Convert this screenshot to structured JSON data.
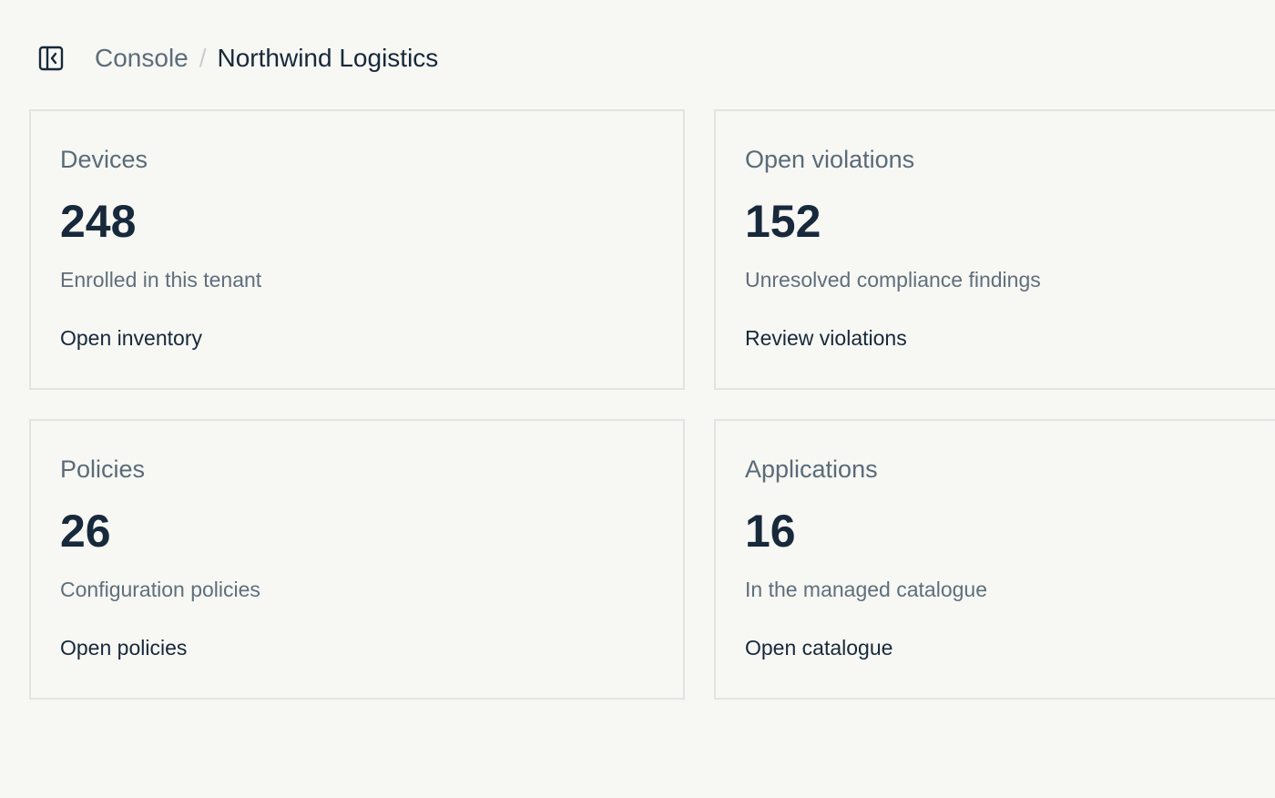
{
  "header": {
    "breadcrumb": {
      "parent": "Console",
      "separator": "/",
      "current": "Northwind Logistics"
    }
  },
  "cards": [
    {
      "title": "Devices",
      "value": "248",
      "description": "Enrolled in this tenant",
      "link": "Open inventory"
    },
    {
      "title": "Open violations",
      "value": "152",
      "description": "Unresolved compliance findings",
      "link": "Review violations"
    },
    {
      "title": "Policies",
      "value": "26",
      "description": "Configuration policies",
      "link": "Open policies"
    },
    {
      "title": "Applications",
      "value": "16",
      "description": "In the managed catalogue",
      "link": "Open catalogue"
    }
  ],
  "colors": {
    "background": "#f7f7f4",
    "text_primary": "#17293a",
    "text_muted": "#5c6d7a",
    "card_border": "#e3e4e1"
  },
  "icons": {
    "sidebar_toggle": "sidebar-collapse-icon"
  }
}
